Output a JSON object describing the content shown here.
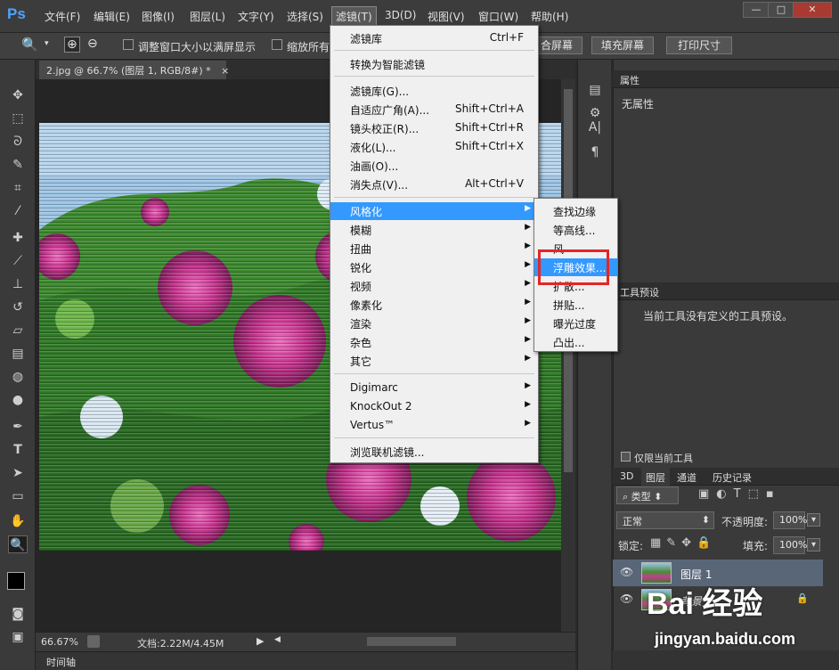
{
  "app": {
    "logo": "Ps"
  },
  "menubar": {
    "items": [
      "文件(F)",
      "编辑(E)",
      "图像(I)",
      "图层(L)",
      "文字(Y)",
      "选择(S)",
      "滤镜(T)",
      "3D(D)",
      "视图(V)",
      "窗口(W)",
      "帮助(H)"
    ],
    "active": "滤镜(T)"
  },
  "window_controls": {
    "minimize": "—",
    "maximize": "□",
    "close": "✕"
  },
  "options_bar": {
    "resize_windows_label": "调整窗口大小以满屏显示",
    "zoom_all_label": "缩放所有",
    "fit_screen_label": "合屏幕",
    "fill_screen_label": "填充屏幕",
    "print_size_label": "打印尺寸"
  },
  "document": {
    "tab_title": "2.jpg @ 66.7% (图层 1, RGB/8#) *",
    "tab_close": "×",
    "zoom": "66.67%",
    "doc_info": "文档:2.22M/4.45M",
    "timeline": "时间轴"
  },
  "filter_menu": {
    "group1": [
      {
        "label": "滤镜库",
        "shortcut": "Ctrl+F"
      }
    ],
    "group2": [
      {
        "label": "转换为智能滤镜"
      }
    ],
    "group3": [
      {
        "label": "滤镜库(G)..."
      },
      {
        "label": "自适应广角(A)...",
        "shortcut": "Shift+Ctrl+A"
      },
      {
        "label": "镜头校正(R)...",
        "shortcut": "Shift+Ctrl+R"
      },
      {
        "label": "液化(L)...",
        "shortcut": "Shift+Ctrl+X"
      },
      {
        "label": "油画(O)..."
      },
      {
        "label": "消失点(V)...",
        "shortcut": "Alt+Ctrl+V"
      }
    ],
    "group4": [
      "风格化",
      "模糊",
      "扭曲",
      "锐化",
      "视频",
      "像素化",
      "渲染",
      "杂色",
      "其它"
    ],
    "group5": [
      "Digimarc",
      "KnockOut 2",
      "Vertus™"
    ],
    "group6": [
      {
        "label": "浏览联机滤镜..."
      }
    ],
    "highlighted": "风格化"
  },
  "stylize_submenu": {
    "items": [
      "查找边缘",
      "等高线...",
      "风",
      "浮雕效果...",
      "扩散...",
      "拼贴...",
      "曝光过度",
      "凸出..."
    ],
    "highlighted": "浮雕效果..."
  },
  "properties_panel": {
    "tab": "属性",
    "content": "无属性"
  },
  "tool_presets_panel": {
    "tab": "工具预设",
    "content": "当前工具没有定义的工具预设。",
    "current_tool_only": "仅限当前工具"
  },
  "layers_panel": {
    "tabs": [
      "3D",
      "图层",
      "通道",
      "历史记录"
    ],
    "active_tab": "图层",
    "filter_kind": "类型",
    "blend_mode": "正常",
    "opacity_label": "不透明度:",
    "opacity_value": "100%",
    "lock_label": "锁定:",
    "fill_label": "填充:",
    "fill_value": "100%",
    "layers": [
      {
        "name": "图层 1",
        "selected": true
      },
      {
        "name": "背景",
        "selected": false
      }
    ]
  },
  "watermark": {
    "logo": "Bai 经验",
    "url": "jingyan.baidu.com"
  },
  "colors": {
    "highlight": "#3399ff",
    "annotation_box": "#e52525",
    "ps_logo": "#4fa3ff"
  }
}
